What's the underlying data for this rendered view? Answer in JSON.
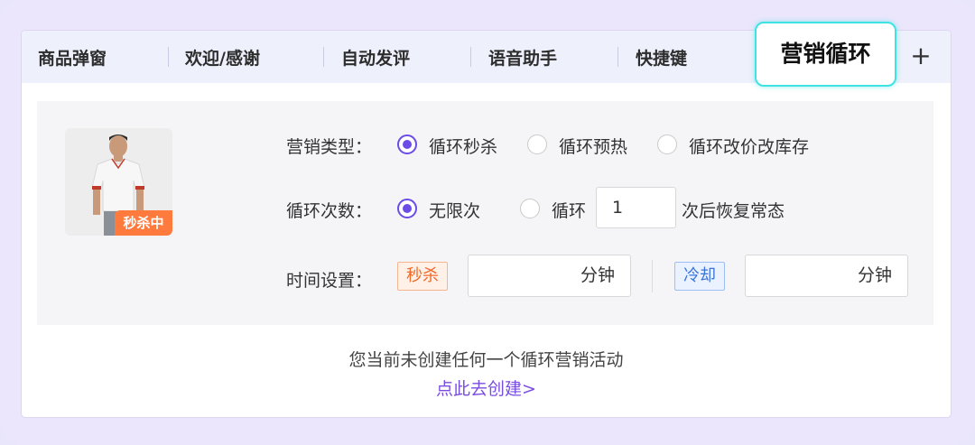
{
  "tabs": [
    {
      "label": "商品弹窗"
    },
    {
      "label": "欢迎/感谢"
    },
    {
      "label": "自动发评"
    },
    {
      "label": "语音助手"
    },
    {
      "label": "快捷键"
    }
  ],
  "active_tab": {
    "label": "营销循环"
  },
  "add_tab_label": "+",
  "product": {
    "badge": "秒杀中"
  },
  "form": {
    "marketing_type": {
      "label": "营销类型：",
      "options": [
        "循环秒杀",
        "循环预热",
        "循环改价改库存"
      ],
      "selected": "循环秒杀"
    },
    "loop_count": {
      "label": "循环次数：",
      "option_unlimited": "无限次",
      "option_loop": "循环",
      "loop_value": "1",
      "suffix": "次后恢复常态",
      "selected": "无限次"
    },
    "time_setting": {
      "label": "时间设置：",
      "kill_tag": "秒杀",
      "kill_unit": "分钟",
      "cool_tag": "冷却",
      "cool_unit": "分钟"
    }
  },
  "empty_state": {
    "message": "您当前未创建任何一个循环营销活动",
    "link": "点此去创建>"
  },
  "colors": {
    "accent": "#6b4ce6",
    "active_tab_border": "#3fe3e3",
    "badge": "#ff7a3d",
    "link": "#7a4de0"
  }
}
